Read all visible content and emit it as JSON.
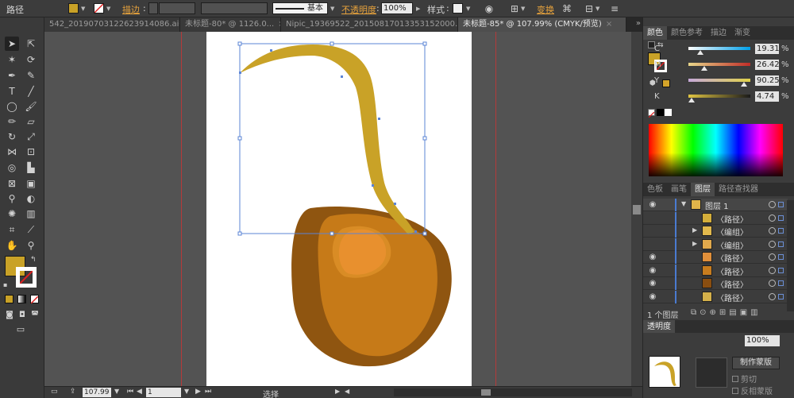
{
  "control_bar": {
    "object_type": "路径",
    "stroke_label": "描边",
    "stroke_profile": "基本",
    "opacity_label": "不透明度",
    "opacity_value": "100%",
    "style_label": "样式",
    "transform_label": "变换",
    "fill_color": "#c9a227"
  },
  "tabs": [
    {
      "label": "542_20190703122623914086.ai*",
      "close": "×"
    },
    {
      "label": "未标题-80* @ 1126.0...",
      "close": "×"
    },
    {
      "label": "Nipic_19369522_20150817013353152000.ai*",
      "close": "×"
    },
    {
      "label": "未标题-85* @ 107.99% (CMYK/预览)",
      "close": "×"
    }
  ],
  "status_bar": {
    "zoom": "107.99",
    "page": "1",
    "mode": "选择"
  },
  "color_panel": {
    "tabs": [
      "颜色",
      "颜色参考",
      "描边",
      "渐变"
    ],
    "channels": [
      {
        "name": "C",
        "value": "19.31",
        "fraction": 0.19,
        "gradient": "linear-gradient(to right,#fff,#00a0e9)"
      },
      {
        "name": "M",
        "value": "26.42",
        "fraction": 0.26,
        "gradient": "linear-gradient(to right,#e8d68a,#c02d28)"
      },
      {
        "name": "Y",
        "value": "90.25",
        "fraction": 0.9,
        "gradient": "linear-gradient(to right,#c6a9d9,#e0d24a)"
      },
      {
        "name": "K",
        "value": "4.74",
        "fraction": 0.05,
        "gradient": "linear-gradient(to right,#e1c542,#1a1a1a)"
      }
    ],
    "percent": "%"
  },
  "layers_panel": {
    "tabs": [
      "色板",
      "画笔",
      "图层",
      "路径查找器"
    ],
    "rows": [
      {
        "name": "图层 1",
        "visible": true,
        "expander": "▼",
        "thumb_color": "#e0b44a"
      },
      {
        "name": "〈路径〉",
        "visible": false,
        "expander": "",
        "thumb_color": "#d4ae3a"
      },
      {
        "name": "〈编组〉",
        "visible": false,
        "expander": "▶",
        "thumb_color": "#e1b84c"
      },
      {
        "name": "〈编组〉",
        "visible": false,
        "expander": "▶",
        "thumb_color": "#e1a94c"
      },
      {
        "name": "〈路径〉",
        "visible": true,
        "expander": "",
        "thumb_color": "#e08f3a"
      },
      {
        "name": "〈路径〉",
        "visible": true,
        "expander": "",
        "thumb_color": "#c77c1e"
      },
      {
        "name": "〈路径〉",
        "visible": true,
        "expander": "",
        "thumb_color": "#8a4e10"
      },
      {
        "name": "〈路径〉",
        "visible": true,
        "expander": "",
        "thumb_color": "#d4b04a"
      }
    ],
    "footer_count": "1 个图层"
  },
  "transparency_panel": {
    "title": "透明度",
    "opacity": "100%",
    "make_mask": "制作蒙版",
    "clip": "剪切",
    "invert_mask": "反相蒙版"
  },
  "artwork": {
    "stem_color": "#c9a227",
    "body_dark": "#8f5510",
    "body_main": "#c67a18",
    "highlight_outer": "#d98c25",
    "highlight_inner": "#e8902e"
  }
}
